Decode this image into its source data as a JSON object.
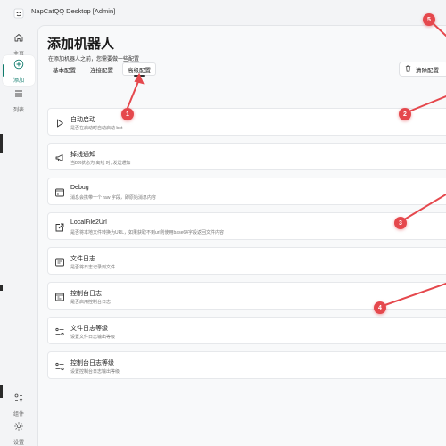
{
  "window": {
    "title": "NapCatQQ Desktop [Admin]"
  },
  "sidebar": {
    "items": [
      {
        "label": "主页",
        "icon": "home-icon"
      },
      {
        "label": "添加",
        "icon": "add-circle-icon"
      },
      {
        "label": "列表",
        "icon": "list-icon"
      },
      {
        "label": "组件",
        "icon": "components-icon"
      },
      {
        "label": "设置",
        "icon": "gear-icon"
      }
    ]
  },
  "page": {
    "title": "添加机器人",
    "subtitle": "在添加机器人之前，您需要做一些配置"
  },
  "tabs": [
    {
      "label": "基本配置"
    },
    {
      "label": "连接配置"
    },
    {
      "label": "高级配置"
    }
  ],
  "clear_button": {
    "label": "清除配置"
  },
  "settings": [
    {
      "title": "自动启动",
      "desc": "是否在启动时自动启动 bot",
      "icon": "play-icon"
    },
    {
      "title": "掉线通知",
      "desc": "当bot状态为 离线 时, 发送通知",
      "icon": "megaphone-icon"
    },
    {
      "title": "Debug",
      "desc": "消息会携带一个 raw 字段，即原始消息内容",
      "icon": "debug-icon"
    },
    {
      "title": "LocalFile2Url",
      "desc": "是否将本地文件转换为URL，如果获取不到url则使用base64字段返回文件内容",
      "icon": "share-icon"
    },
    {
      "title": "文件日志",
      "desc": "是否将日志记录到文件",
      "icon": "file-log-icon"
    },
    {
      "title": "控制台日志",
      "desc": "是否启用控制台日志",
      "icon": "console-icon"
    },
    {
      "title": "文件日志等级",
      "desc": "设置文件日志输出等级",
      "icon": "level-icon"
    },
    {
      "title": "控制台日志等级",
      "desc": "设置控制台日志输出等级",
      "icon": "level-icon"
    }
  ],
  "annotations": [
    {
      "label": "1"
    },
    {
      "label": "2"
    },
    {
      "label": "3"
    },
    {
      "label": "4"
    },
    {
      "label": "5"
    }
  ],
  "colors": {
    "accent": "#0f7b6c",
    "annotation": "#e5484d"
  }
}
